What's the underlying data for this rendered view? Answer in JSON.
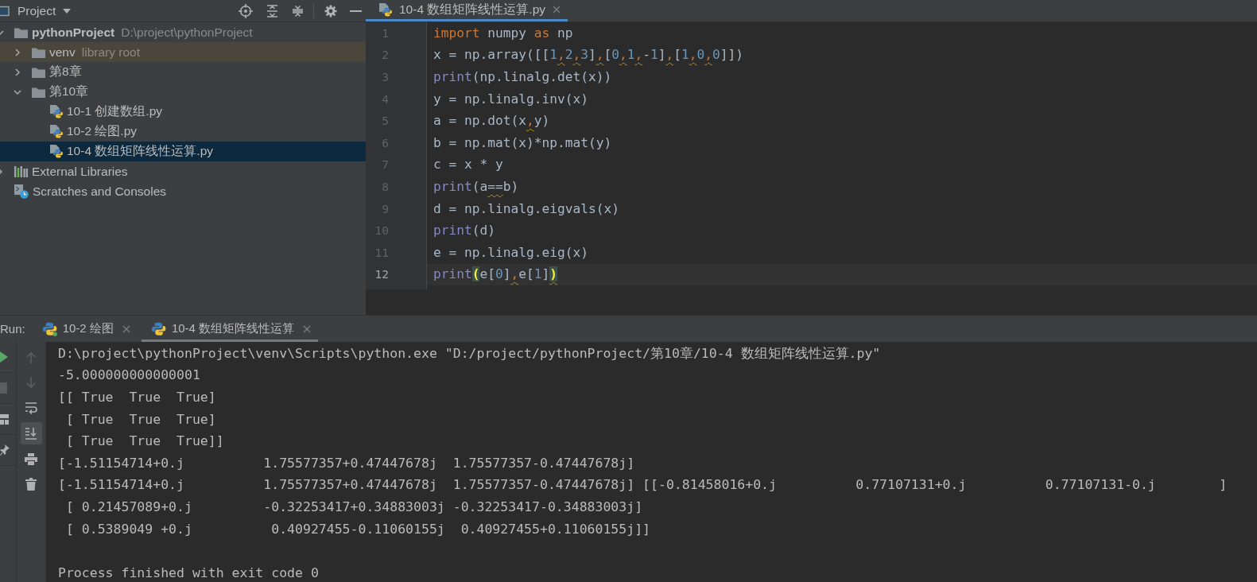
{
  "project_panel": {
    "title": "Project",
    "tree": [
      {
        "label": "pythonProject",
        "note": "D:\\project\\pythonProject",
        "kind": "project",
        "expanded": true,
        "selected": false,
        "highlighted": false,
        "children": [
          {
            "label": "venv",
            "note": "library root",
            "kind": "folder",
            "expanded": false,
            "selected": false,
            "highlighted": true
          },
          {
            "label": "第8章",
            "kind": "folder",
            "expanded": false,
            "selected": false,
            "highlighted": false
          },
          {
            "label": "第10章",
            "kind": "folder",
            "expanded": true,
            "selected": false,
            "highlighted": false,
            "children": [
              {
                "label": "10-1 创建数组.py",
                "kind": "python_file",
                "selected": false,
                "highlighted": false
              },
              {
                "label": "10-2 绘图.py",
                "kind": "python_file",
                "selected": false,
                "highlighted": false
              },
              {
                "label": "10-4 数组矩阵线性运算.py",
                "kind": "python_file",
                "selected": true,
                "highlighted": false
              }
            ]
          }
        ]
      },
      {
        "label": "External Libraries",
        "kind": "libraries",
        "expanded": false,
        "selected": false,
        "highlighted": false
      },
      {
        "label": "Scratches and Consoles",
        "kind": "scratches",
        "selected": false,
        "highlighted": false
      }
    ]
  },
  "editor": {
    "tabs": [
      {
        "label": "10-4 数组矩阵线性运算.py",
        "selected": true
      }
    ],
    "lines": [
      {
        "number": "1",
        "current": false,
        "tokens": [
          {
            "text": "import",
            "kind": "keyword"
          },
          {
            "text": " numpy ",
            "kind": "plain"
          },
          {
            "text": "as",
            "kind": "keyword"
          },
          {
            "text": " np",
            "kind": "plain"
          }
        ]
      },
      {
        "number": "2",
        "current": false,
        "tokens": [
          {
            "text": "x = np.array([[",
            "kind": "plain"
          },
          {
            "text": "1",
            "kind": "number"
          },
          {
            "text": ",",
            "kind": "comma"
          },
          {
            "text": "2",
            "kind": "number"
          },
          {
            "text": ",",
            "kind": "comma"
          },
          {
            "text": "3",
            "kind": "number"
          },
          {
            "text": "]",
            "kind": "plain"
          },
          {
            "text": ",",
            "kind": "comma"
          },
          {
            "text": "[",
            "kind": "plain"
          },
          {
            "text": "0",
            "kind": "number"
          },
          {
            "text": ",",
            "kind": "comma"
          },
          {
            "text": "1",
            "kind": "number"
          },
          {
            "text": ",",
            "kind": "comma"
          },
          {
            "text": "-",
            "kind": "plain"
          },
          {
            "text": "1",
            "kind": "number"
          },
          {
            "text": "]",
            "kind": "plain"
          },
          {
            "text": ",",
            "kind": "comma"
          },
          {
            "text": "[",
            "kind": "plain"
          },
          {
            "text": "1",
            "kind": "number"
          },
          {
            "text": ",",
            "kind": "comma"
          },
          {
            "text": "0",
            "kind": "number"
          },
          {
            "text": ",",
            "kind": "comma"
          },
          {
            "text": "0",
            "kind": "number"
          },
          {
            "text": "]])",
            "kind": "plain"
          }
        ]
      },
      {
        "number": "3",
        "current": false,
        "tokens": [
          {
            "text": "print",
            "kind": "builtin"
          },
          {
            "text": "(np.linalg.det(x))",
            "kind": "plain"
          }
        ]
      },
      {
        "number": "4",
        "current": false,
        "tokens": [
          {
            "text": "y = np.linalg.inv(x)",
            "kind": "plain"
          }
        ]
      },
      {
        "number": "5",
        "current": false,
        "tokens": [
          {
            "text": "a = np.dot(x",
            "kind": "plain"
          },
          {
            "text": ",",
            "kind": "comma"
          },
          {
            "text": "y)",
            "kind": "plain"
          }
        ]
      },
      {
        "number": "6",
        "current": false,
        "tokens": [
          {
            "text": "b = np.mat(x)*np.mat(y)",
            "kind": "plain"
          }
        ]
      },
      {
        "number": "7",
        "current": false,
        "tokens": [
          {
            "text": "c = x * y",
            "kind": "plain"
          }
        ]
      },
      {
        "number": "8",
        "current": false,
        "tokens": [
          {
            "text": "print",
            "kind": "builtin"
          },
          {
            "text": "(a",
            "kind": "plain"
          },
          {
            "text": "==",
            "kind": "weak"
          },
          {
            "text": "b)",
            "kind": "plain"
          }
        ]
      },
      {
        "number": "9",
        "current": false,
        "tokens": [
          {
            "text": "d = np.linalg.eigvals(x)",
            "kind": "plain"
          }
        ]
      },
      {
        "number": "10",
        "current": false,
        "tokens": [
          {
            "text": "print",
            "kind": "builtin"
          },
          {
            "text": "(d)",
            "kind": "plain"
          }
        ]
      },
      {
        "number": "11",
        "current": false,
        "tokens": [
          {
            "text": "e = np.linalg.eig(x)",
            "kind": "plain"
          }
        ]
      },
      {
        "number": "12",
        "current": true,
        "tokens": [
          {
            "text": "print",
            "kind": "builtin"
          },
          {
            "text": "(",
            "kind": "brace"
          },
          {
            "text": "e[",
            "kind": "plain"
          },
          {
            "text": "0",
            "kind": "number"
          },
          {
            "text": "]",
            "kind": "plain"
          },
          {
            "text": ",",
            "kind": "comma"
          },
          {
            "text": "e[",
            "kind": "plain"
          },
          {
            "text": "1",
            "kind": "number"
          },
          {
            "text": "]",
            "kind": "plain"
          },
          {
            "text": ")",
            "kind": "brace_weak"
          }
        ]
      }
    ]
  },
  "run_panel": {
    "label": "Run:",
    "tabs": [
      {
        "label": "10-2 绘图",
        "selected": false,
        "running": true
      },
      {
        "label": "10-4 数组矩阵线性运算",
        "selected": true,
        "running": false
      }
    ],
    "side_tools": [
      {
        "disabled": false
      },
      {
        "disabled": true
      },
      {
        "disabled": false
      },
      {
        "disabled": false
      }
    ],
    "console_tools": [
      {
        "disabled": true,
        "on": false
      },
      {
        "disabled": true,
        "on": false
      },
      {
        "disabled": false,
        "on": false
      },
      {
        "disabled": false,
        "on": true
      },
      {
        "disabled": false,
        "on": false
      },
      {
        "disabled": false,
        "on": false
      }
    ],
    "output": [
      "D:\\project\\pythonProject\\venv\\Scripts\\python.exe \"D:/project/pythonProject/第10章/10-4 数组矩阵线性运算.py\"",
      "-5.000000000000001",
      "[[ True  True  True]",
      " [ True  True  True]",
      " [ True  True  True]]",
      "[-1.51154714+0.j          1.75577357+0.47447678j  1.75577357-0.47447678j]",
      "[-1.51154714+0.j          1.75577357+0.47447678j  1.75577357-0.47447678j] [[-0.81458016+0.j          0.77107131+0.j          0.77107131-0.j        ]",
      " [ 0.21457089+0.j         -0.32253417+0.34883003j -0.32253417-0.34883003j]",
      " [ 0.5389049 +0.j          0.40927455-0.11060155j  0.40927455+0.11060155j]]"
    ],
    "exit_message": "Process finished with exit code 0"
  }
}
